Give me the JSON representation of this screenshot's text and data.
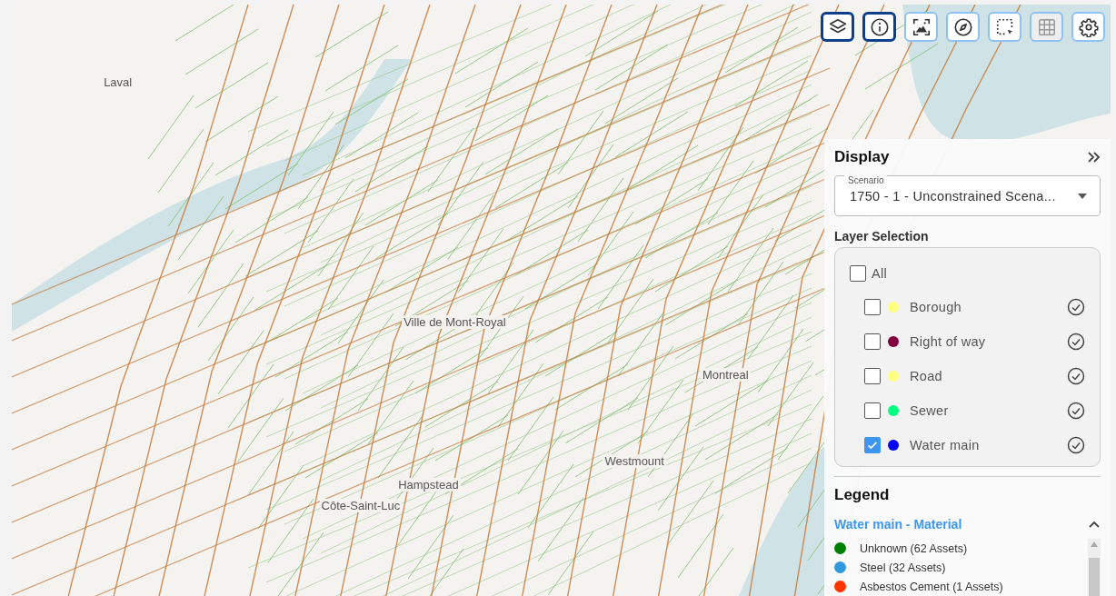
{
  "toolbar": [
    {
      "kind": "layers",
      "selected": true,
      "disabled": false
    },
    {
      "kind": "info",
      "selected": true,
      "disabled": false
    },
    {
      "kind": "image",
      "selected": false,
      "disabled": false
    },
    {
      "kind": "compass",
      "selected": false,
      "disabled": false
    },
    {
      "kind": "select",
      "selected": false,
      "disabled": false
    },
    {
      "kind": "grid",
      "selected": false,
      "disabled": true
    },
    {
      "kind": "settings",
      "selected": false,
      "disabled": false
    }
  ],
  "map_labels": [
    {
      "text": "Laval"
    },
    {
      "text": "Ville de Mont-Royal"
    },
    {
      "text": "Montreal"
    },
    {
      "text": "Westmount"
    },
    {
      "text": "Hampstead"
    },
    {
      "text": "Côte-Saint-Luc"
    }
  ],
  "display": {
    "title": "Display",
    "scenario": {
      "label": "Scenario",
      "value": "1750 - 1 - Unconstrained Scena..."
    },
    "layer_selection": {
      "title": "Layer Selection",
      "all": {
        "label": "All",
        "checked": false
      },
      "layers": [
        {
          "label": "Borough",
          "checked": false,
          "color": "#ffff80"
        },
        {
          "label": "Right of way",
          "checked": false,
          "color": "#800040"
        },
        {
          "label": "Road",
          "checked": false,
          "color": "#ffff80"
        },
        {
          "label": "Sewer",
          "checked": false,
          "color": "#00ff80"
        },
        {
          "label": "Water main",
          "checked": true,
          "color": "#0000ff"
        }
      ]
    }
  },
  "legend": {
    "title": "Legend",
    "group": {
      "title": "Water main - Material",
      "expanded": true,
      "items": [
        {
          "label": "Unknown (62 Assets)",
          "color": "#008000"
        },
        {
          "label": "Steel (32 Assets)",
          "color": "#3399dd"
        },
        {
          "label": "Asbestos Cement (1 Assets)",
          "color": "#ff3300"
        }
      ]
    }
  }
}
